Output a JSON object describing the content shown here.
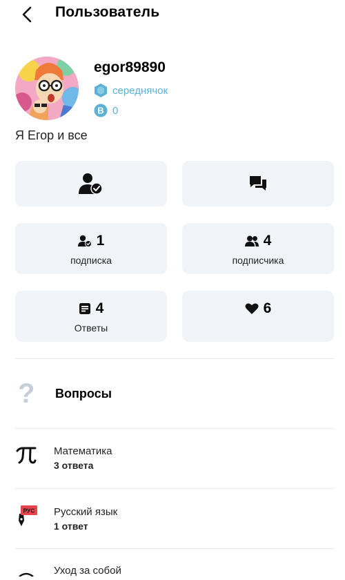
{
  "header": {
    "title": "Пользователь"
  },
  "profile": {
    "username": "egor89890",
    "rank": "середнячок",
    "points": "0",
    "bio": "Я Егор и все"
  },
  "stats": {
    "subscriptions": {
      "count": "1",
      "label": "подписка"
    },
    "subscribers": {
      "count": "4",
      "label": "подписчика"
    },
    "answers": {
      "count": "4",
      "label": "Ответы"
    },
    "thanks": {
      "count": "6"
    }
  },
  "questions": {
    "title": "Вопросы"
  },
  "subjects": [
    {
      "name": "Математика",
      "count": "3 ответа",
      "badge": ""
    },
    {
      "name": "Русский язык",
      "count": "1 ответ",
      "badge": "РУС"
    },
    {
      "name": "Уход за собой",
      "count": ""
    }
  ],
  "colors": {
    "accent": "#5bb1d6",
    "card_bg": "#f0f3f7",
    "divider": "#e6e9ee",
    "badge_red": "#e6454d"
  }
}
